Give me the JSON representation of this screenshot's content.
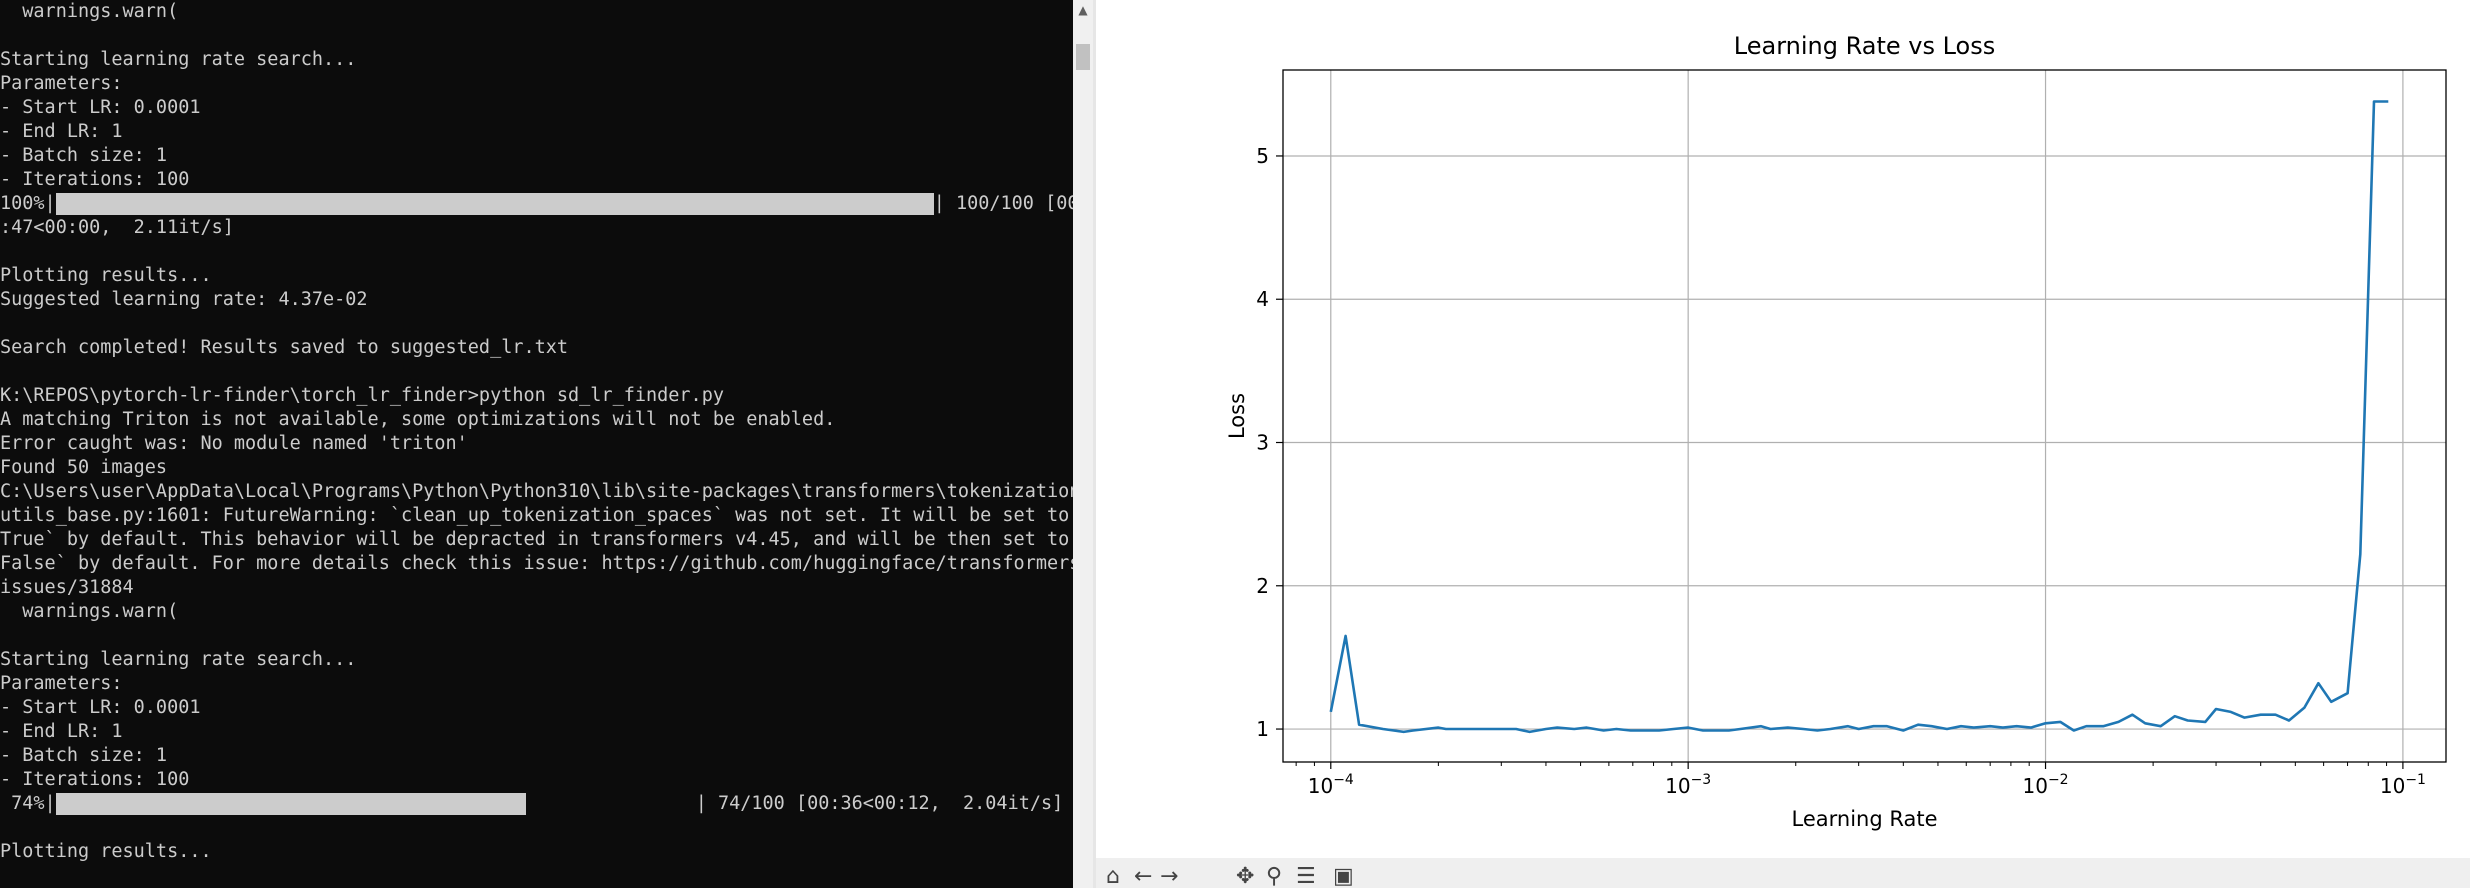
{
  "terminal": {
    "lines": [
      {
        "text": "  warnings.warn("
      },
      {
        "text": ""
      },
      {
        "text": "Starting learning rate search..."
      },
      {
        "text": "Parameters:"
      },
      {
        "text": "- Start LR: 0.0001"
      },
      {
        "text": "- End LR: 1"
      },
      {
        "text": "- Batch size: 1"
      },
      {
        "text": "- Iterations: 100"
      },
      {
        "progress": true,
        "prefix": "100%|",
        "fraction": 1.0,
        "suffix": "| 100/100 [00"
      },
      {
        "text": ":47<00:00,  2.11it/s]"
      },
      {
        "text": ""
      },
      {
        "text": "Plotting results..."
      },
      {
        "text": "Suggested learning rate: 4.37e-02"
      },
      {
        "text": ""
      },
      {
        "text": "Search completed! Results saved to suggested_lr.txt"
      },
      {
        "text": ""
      },
      {
        "text": "K:\\REPOS\\pytorch-lr-finder\\torch_lr_finder>python sd_lr_finder.py"
      },
      {
        "text": "A matching Triton is not available, some optimizations will not be enabled."
      },
      {
        "text": "Error caught was: No module named 'triton'"
      },
      {
        "text": "Found 50 images"
      },
      {
        "text": "C:\\Users\\user\\AppData\\Local\\Programs\\Python\\Python310\\lib\\site-packages\\transformers\\tokenization_"
      },
      {
        "text": "utils_base.py:1601: FutureWarning: `clean_up_tokenization_spaces` was not set. It will be set to `"
      },
      {
        "text": "True` by default. This behavior will be depracted in transformers v4.45, and will be then set to `"
      },
      {
        "text": "False` by default. For more details check this issue: https://github.com/huggingface/transformers/"
      },
      {
        "text": "issues/31884"
      },
      {
        "text": "  warnings.warn("
      },
      {
        "text": ""
      },
      {
        "text": "Starting learning rate search..."
      },
      {
        "text": "Parameters:"
      },
      {
        "text": "- Start LR: 0.0001"
      },
      {
        "text": "- End LR: 1"
      },
      {
        "text": "- Batch size: 1"
      },
      {
        "text": "- Iterations: 100"
      },
      {
        "progress": true,
        "prefix": " 74%|",
        "fraction": 0.74,
        "suffix": "| 74/100 [00:36<00:12,  2.04it/s]"
      },
      {
        "text": ""
      },
      {
        "text": "Plotting results..."
      }
    ]
  },
  "plot_toolbar": {
    "icons": [
      "home-icon",
      "back-icon",
      "forward-icon",
      "pan-icon",
      "zoom-icon",
      "subplots-icon",
      "save-icon"
    ]
  },
  "chart_data": {
    "type": "line",
    "title": "Learning Rate vs Loss",
    "xlabel": "Learning Rate",
    "ylabel": "Loss",
    "xscale": "log",
    "xlim": [
      7.35e-05,
      0.132
    ],
    "ylim": [
      0.77,
      5.6
    ],
    "x_ticks": [
      0.0001,
      0.001,
      0.01,
      0.1
    ],
    "x_tick_labels": [
      {
        "base": "10",
        "exp": "−4"
      },
      {
        "base": "10",
        "exp": "−3"
      },
      {
        "base": "10",
        "exp": "−2"
      },
      {
        "base": "10",
        "exp": "−1"
      }
    ],
    "y_ticks": [
      1,
      2,
      3,
      4,
      5
    ],
    "y_tick_labels": [
      "1",
      "2",
      "3",
      "4",
      "5"
    ],
    "grid": true,
    "line_color": "#1f77b4",
    "series": [
      {
        "x": [
          0.0001,
          0.00011,
          0.00012,
          0.00014,
          0.00016,
          0.00017,
          0.0002,
          0.00021,
          0.00024,
          0.00026,
          0.0003,
          0.00033,
          0.00036,
          0.0004,
          0.00043,
          0.00048,
          0.00052,
          0.00058,
          0.00063,
          0.00069,
          0.00076,
          0.00083,
          0.00091,
          0.001,
          0.0011,
          0.0012,
          0.0013,
          0.0014,
          0.0016,
          0.0017,
          0.0019,
          0.0021,
          0.0023,
          0.0025,
          0.0028,
          0.003,
          0.0033,
          0.0036,
          0.004,
          0.0044,
          0.0048,
          0.0053,
          0.0058,
          0.0063,
          0.007,
          0.0076,
          0.0083,
          0.0091,
          0.01,
          0.011,
          0.012,
          0.013,
          0.0145,
          0.016,
          0.0175,
          0.019,
          0.021,
          0.023,
          0.025,
          0.028,
          0.03,
          0.033,
          0.036,
          0.04,
          0.044,
          0.048,
          0.053,
          0.058,
          0.063,
          0.07,
          0.076,
          0.083,
          0.091
        ],
        "y": [
          1.12,
          1.65,
          1.03,
          1.0,
          0.98,
          0.99,
          1.01,
          1.0,
          1.0,
          1.0,
          1.0,
          1.0,
          0.98,
          1.0,
          1.01,
          1.0,
          1.01,
          0.99,
          1.0,
          0.99,
          0.99,
          0.99,
          1.0,
          1.01,
          0.99,
          0.99,
          0.99,
          1.0,
          1.02,
          1.0,
          1.01,
          1.0,
          0.99,
          1.0,
          1.02,
          1.0,
          1.02,
          1.02,
          0.99,
          1.03,
          1.02,
          1.0,
          1.02,
          1.01,
          1.02,
          1.01,
          1.02,
          1.01,
          1.04,
          1.05,
          0.99,
          1.02,
          1.02,
          1.05,
          1.1,
          1.04,
          1.02,
          1.09,
          1.06,
          1.05,
          1.14,
          1.12,
          1.08,
          1.1,
          1.1,
          1.06,
          1.15,
          1.32,
          1.19,
          1.25,
          2.22,
          5.38,
          5.38
        ]
      }
    ]
  }
}
